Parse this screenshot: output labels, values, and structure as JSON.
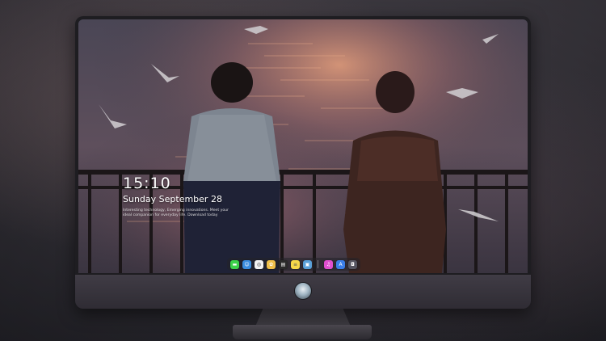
{
  "lockscreen": {
    "time": "15:10",
    "date": "Sunday September 28",
    "tagline": "Interesting technology, Emerging innovations. Meet your ideal companion for everyday life. Download today"
  },
  "dock": {
    "apps": [
      {
        "name": "Messages",
        "icon": "messages-icon",
        "color": "#3bd14a",
        "glyph": "▬"
      },
      {
        "name": "Finder",
        "icon": "finder-icon",
        "color": "#3a8de0",
        "glyph": "☺"
      },
      {
        "name": "Safari",
        "icon": "safari-icon",
        "color": "#f2f2f2",
        "glyph": "◎"
      },
      {
        "name": "Photos",
        "icon": "photos-icon",
        "color": "#f0c04a",
        "glyph": "✿"
      },
      {
        "name": "Final Cut Pro",
        "icon": "clapper-icon",
        "color": "#2a2a2a",
        "glyph": "▤"
      },
      {
        "name": "Notes",
        "icon": "notes-icon",
        "color": "#f7d84a",
        "glyph": "≡"
      },
      {
        "name": "Preview",
        "icon": "preview-icon",
        "color": "#5aa0d8",
        "glyph": "▣"
      },
      {
        "name": "iTunes",
        "icon": "music-icon",
        "color": "#e04fd0",
        "glyph": "♫"
      },
      {
        "name": "App Store",
        "icon": "app-store-icon",
        "color": "#3a7ee8",
        "glyph": "A"
      },
      {
        "name": "Screenshot",
        "icon": "camera-icon",
        "color": "#555560",
        "glyph": "◘"
      }
    ]
  },
  "colors": {
    "sea": "#5b4f5e",
    "sunset": "#d98a6a",
    "railing": "#1b1618"
  }
}
